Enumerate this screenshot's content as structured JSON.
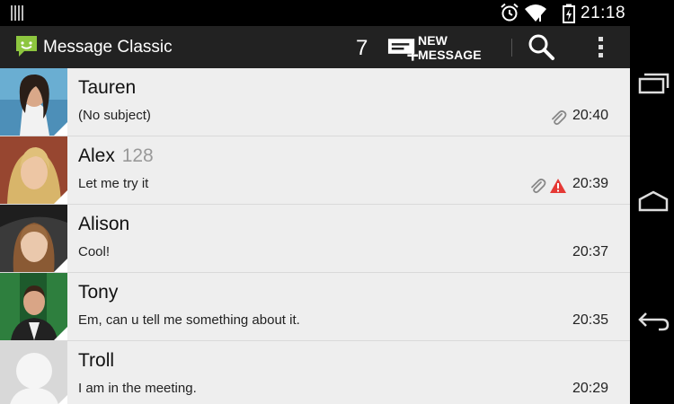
{
  "status_bar": {
    "time": "21:18"
  },
  "action_bar": {
    "title": "Message Classic",
    "unread_count": "7",
    "new_message_label": "NEW MESSAGE"
  },
  "conversations": [
    {
      "name": "Tauren",
      "count": "",
      "snippet": "(No subject)",
      "time": "20:40",
      "has_attachment": true,
      "has_error": false
    },
    {
      "name": "Alex",
      "count": "128",
      "snippet": "Let me try it",
      "time": "20:39",
      "has_attachment": true,
      "has_error": true
    },
    {
      "name": "Alison",
      "count": "",
      "snippet": "Cool!",
      "time": "20:37",
      "has_attachment": false,
      "has_error": false
    },
    {
      "name": "Tony",
      "count": "",
      "snippet": "Em, can u tell me something about it.",
      "time": "20:35",
      "has_attachment": false,
      "has_error": false
    },
    {
      "name": "Troll",
      "count": "",
      "snippet": "I am in the meeting.",
      "time": "20:29",
      "has_attachment": false,
      "has_error": false
    }
  ],
  "colors": {
    "accent": "#8dc63f",
    "error": "#e53935",
    "action_bar": "#222222",
    "list_bg": "#eeeeee"
  }
}
